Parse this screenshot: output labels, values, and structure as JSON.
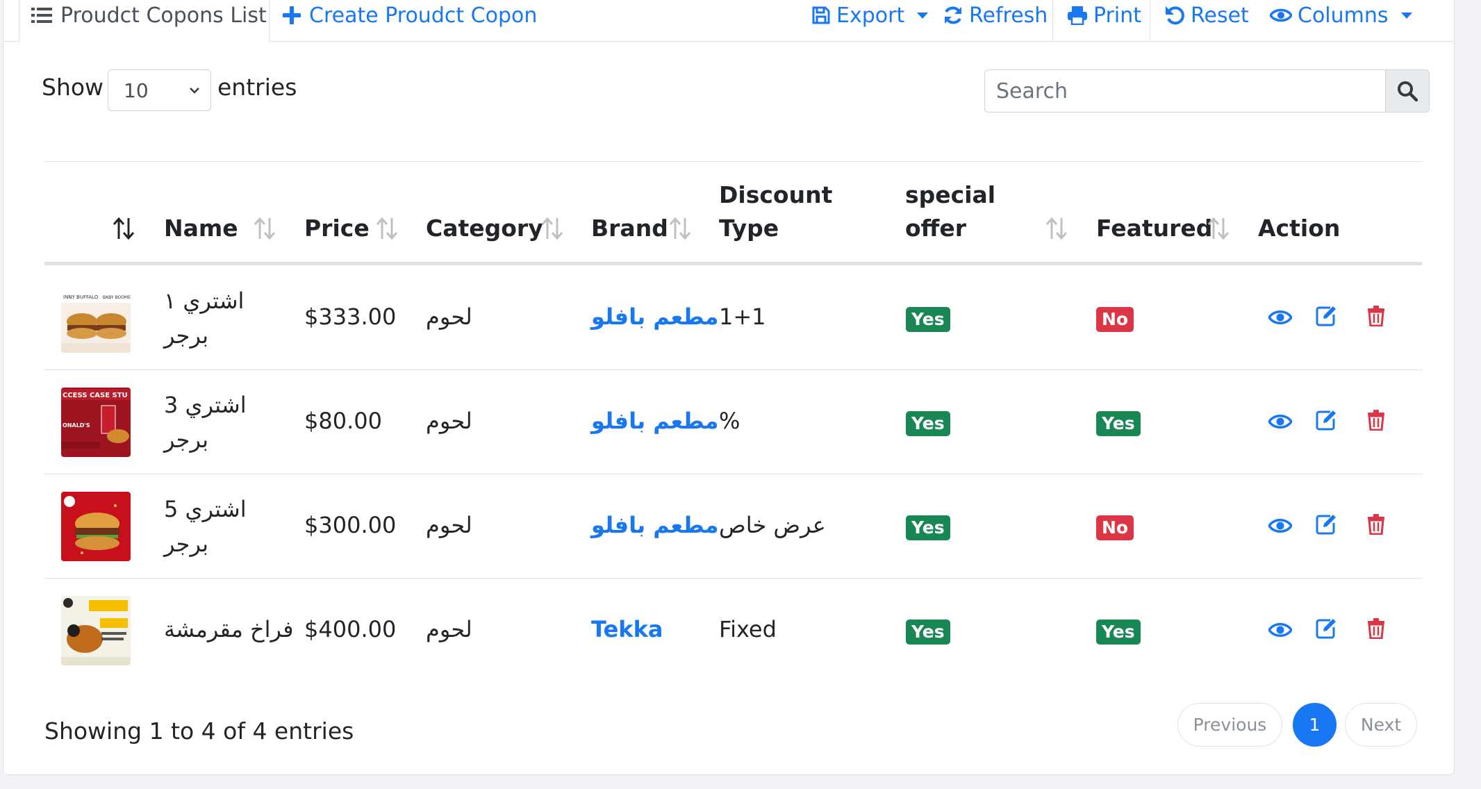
{
  "toolbar": {
    "list_tab": "Proudct Copons List",
    "create_tab": "Create Proudct Copon",
    "export": "Export",
    "refresh": "Refresh",
    "print": "Print",
    "reset": "Reset",
    "columns": "Columns"
  },
  "length_menu": {
    "show": "Show",
    "value": "10",
    "entries": "entries"
  },
  "search": {
    "placeholder": "Search"
  },
  "table": {
    "headers": {
      "name": "Name",
      "price": "Price",
      "category": "Category",
      "brand": "Brand",
      "discount_line1": "Discount",
      "discount_line2": "Type",
      "special_line1": "special",
      "special_line2": "offer",
      "featured": "Featured",
      "action": "Action"
    },
    "rows": [
      {
        "name_line1": "اشتري ١",
        "name_line2": "برجر",
        "price": "$333.00",
        "category": "لحوم",
        "brand": "مطعم بافلو",
        "discount_type": "1+1",
        "special_offer": "Yes",
        "featured": "No"
      },
      {
        "name_line1": "اشتري 3",
        "name_line2": "برجر",
        "price": "$80.00",
        "category": "لحوم",
        "brand": "مطعم بافلو",
        "discount_type": "%",
        "special_offer": "Yes",
        "featured": "Yes"
      },
      {
        "name_line1": "اشتري 5",
        "name_line2": "برجر",
        "price": "$300.00",
        "category": "لحوم",
        "brand": "مطعم بافلو",
        "discount_type": "عرض خاص",
        "special_offer": "Yes",
        "featured": "No"
      },
      {
        "name_line1": "فراخ مقرمشة",
        "name_line2": "",
        "price": "$400.00",
        "category": "لحوم",
        "brand": "Tekka",
        "discount_type": "Fixed",
        "special_offer": "Yes",
        "featured": "Yes"
      }
    ]
  },
  "footer": {
    "info": "Showing 1 to 4 of 4 entries",
    "previous": "Previous",
    "page": "1",
    "next": "Next"
  },
  "colors": {
    "primary": "#1877f2",
    "success": "#198754",
    "danger": "#dc3545"
  }
}
